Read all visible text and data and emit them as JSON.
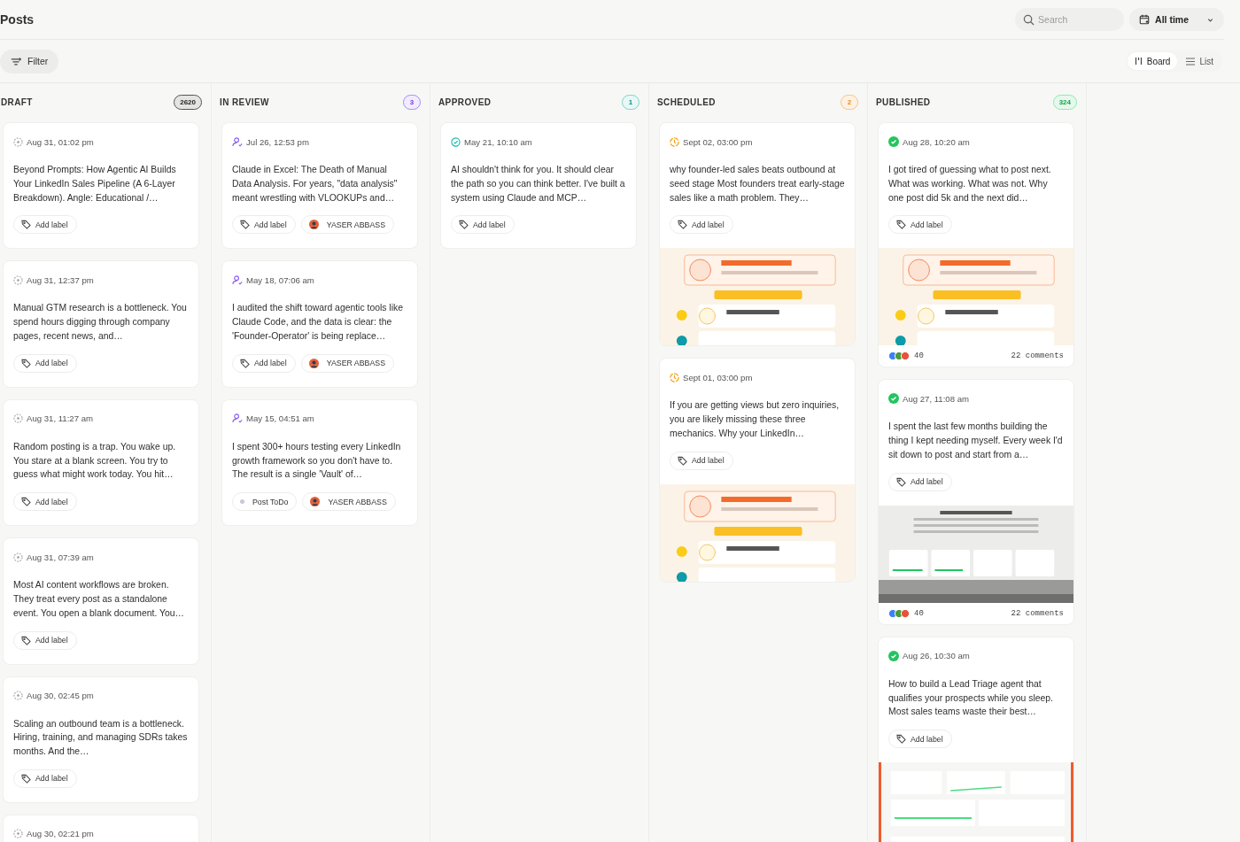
{
  "title": "Posts",
  "search": {
    "placeholder": "Search"
  },
  "date_range": {
    "label": "All time"
  },
  "filter": {
    "label": "Filter"
  },
  "view_modes": [
    {
      "kind": "board",
      "label": "Board",
      "selected": true
    },
    {
      "kind": "list",
      "label": "List",
      "selected": false
    }
  ],
  "columns": [
    {
      "kind": "draft",
      "title": "DRAFT",
      "count": "2620",
      "cards": [
        {
          "date": "Aug 31, 01:02 pm",
          "text": "Beyond Prompts: How Agentic AI Builds Your LinkedIn Sales Pipeline (A 6-Layer Breakdown). Angle: Educational /…",
          "chips": [
            {
              "kind": "label",
              "text": "Add label"
            }
          ]
        },
        {
          "date": "Aug 31, 12:37 pm",
          "text": "Manual GTM research is a bottleneck. You spend hours digging through company pages, recent news, and…",
          "chips": [
            {
              "kind": "label",
              "text": "Add label"
            }
          ]
        },
        {
          "date": "Aug 31, 11:27 am",
          "text": "Random posting is a trap. You wake up. You stare at a blank screen. You try to guess what might work today. You hit…",
          "chips": [
            {
              "kind": "label",
              "text": "Add label"
            }
          ]
        },
        {
          "date": "Aug 31, 07:39 am",
          "text": "Most AI content workflows are broken. They treat every post as a standalone event. You open a blank document. You…",
          "chips": [
            {
              "kind": "label",
              "text": "Add label"
            }
          ]
        },
        {
          "date": "Aug 30, 02:45 pm",
          "text": "Scaling an outbound team is a bottleneck. Hiring, training, and managing SDRs takes months. And the…",
          "chips": [
            {
              "kind": "label",
              "text": "Add label"
            }
          ]
        },
        {
          "date": "Aug 30, 02:21 pm"
        }
      ]
    },
    {
      "kind": "review",
      "title": "IN REVIEW",
      "count": "3",
      "cards": [
        {
          "date": "Jul 26, 12:53 pm",
          "text": "Claude in Excel: The Death of Manual Data Analysis. For years, \"data analysis\" meant wrestling with VLOOKUPs and…",
          "chips": [
            {
              "kind": "label",
              "text": "Add label"
            },
            {
              "kind": "assignee",
              "text": "YASER ABBASS"
            }
          ]
        },
        {
          "date": "May 18, 07:06 am",
          "text": "I audited the shift toward agentic tools like Claude Code, and the data is clear: the 'Founder-Operator' is being replace…",
          "chips": [
            {
              "kind": "label",
              "text": "Add label"
            },
            {
              "kind": "assignee",
              "text": "YASER ABBASS"
            }
          ]
        },
        {
          "date": "May 15, 04:51 am",
          "text": "I spent 300+ hours testing every LinkedIn growth framework so you don't have to. The result is a single 'Vault' of…",
          "chips": [
            {
              "kind": "status",
              "text": "Post ToDo"
            },
            {
              "kind": "assignee",
              "text": "YASER ABBASS"
            }
          ]
        }
      ]
    },
    {
      "kind": "approved",
      "title": "APPROVED",
      "count": "1",
      "cards": [
        {
          "date": "May 21, 10:10 am",
          "text": "AI shouldn't think for you. It should clear the path so you can think better. I've built a system using Claude and MCP…",
          "chips": [
            {
              "kind": "label",
              "text": "Add label"
            }
          ]
        }
      ]
    },
    {
      "kind": "scheduled",
      "title": "SCHEDULED",
      "count": "2",
      "cards": [
        {
          "date": "Sept 02, 03:00 pm",
          "text": "why founder-led sales beats outbound at seed stage Most founders treat early-stage sales like a math problem. They…",
          "chips": [
            {
              "kind": "label",
              "text": "Add label"
            }
          ],
          "image": {
            "kind": "picture"
          }
        },
        {
          "date": "Sept 01, 03:00 pm",
          "text": "If you are getting views but zero inquiries, you are likely missing these three mechanics. Why your LinkedIn…",
          "chips": [
            {
              "kind": "label",
              "text": "Add label"
            }
          ],
          "image": {
            "kind": "picture"
          }
        }
      ]
    },
    {
      "kind": "published",
      "title": "PUBLISHED",
      "count": "324",
      "cards": [
        {
          "date": "Aug 28, 10:20 am",
          "text": "I got tired of guessing what to post next. What was working. What was not. Why one post did 5k and the next did…",
          "chips": [
            {
              "kind": "label",
              "text": "Add label"
            }
          ],
          "image": {
            "kind": "picture"
          },
          "reactions": {
            "count": "40",
            "comments": "22 comments"
          }
        },
        {
          "date": "Aug 27, 11:08 am",
          "text": "I spent the last few months building the thing I kept needing myself. Every week I'd sit down to post and start from a…",
          "chips": [
            {
              "kind": "label",
              "text": "Add label"
            }
          ],
          "image": {
            "kind": "picture"
          },
          "reactions": {
            "count": "40",
            "comments": "22 comments"
          }
        },
        {
          "date": "Aug 26, 10:30 am",
          "text": "How to build a Lead Triage agent that qualifies your prospects while you sleep. Most sales teams waste their best…",
          "chips": [
            {
              "kind": "label",
              "text": "Add label"
            }
          ],
          "image": {
            "kind": "picture"
          }
        }
      ]
    }
  ]
}
